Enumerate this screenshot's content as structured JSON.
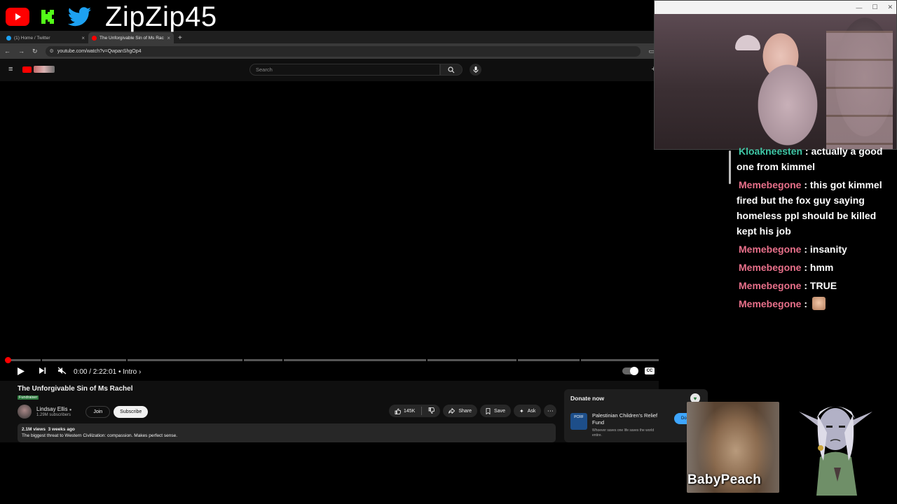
{
  "overlay": {
    "handle": "ZipZip45",
    "icons": [
      "youtube-icon",
      "kick-icon",
      "twitter-icon"
    ]
  },
  "browser": {
    "tabs": [
      {
        "label": "(1) Home / Twitter",
        "active": false
      },
      {
        "label": "The Unforgivable Sin of Ms Rac",
        "active": true
      }
    ],
    "url": "youtube.com/watch?v=QwpanShgOp4"
  },
  "youtube": {
    "search_placeholder": "Search",
    "player": {
      "timecode": "0:00 / 2:22:01",
      "chapter": "Intro",
      "progress": 0
    },
    "video": {
      "title": "The Unforgivable Sin of Ms Rachel",
      "badge": "Fundraiser",
      "channel": "Lindsay Ellis",
      "subscribers": "1.29M subscribers",
      "join_label": "Join",
      "subscribe_label": "Subscribe",
      "likes": "145K",
      "share_label": "Share",
      "save_label": "Save",
      "ask_label": "Ask",
      "views": "2.1M views",
      "age": "3 weeks ago",
      "description": "The biggest threat to Western Civilization: compassion. Makes perfect sense."
    },
    "donate": {
      "title": "Donate now",
      "logo_text": "PCRF",
      "org": "Palestinian Children's Relief Fund",
      "tagline": "Whoever saves one life saves the world entire.",
      "button": "Do"
    }
  },
  "chat": {
    "messages": [
      {
        "user": "Kloakneesten",
        "text": "actually a good one from kimmel",
        "color": "#3fc7a6"
      },
      {
        "user": "Memebegone",
        "text": "this got kimmel fired but the fox guy saying homeless ppl should be killed kept his job",
        "color": "#e8708a"
      },
      {
        "user": "Memebegone",
        "text": "insanity",
        "color": "#e8708a"
      },
      {
        "user": "Memebegone",
        "text": "hmm",
        "color": "#e8708a"
      },
      {
        "user": "Memebegone",
        "text": "TRUE",
        "color": "#e8708a"
      },
      {
        "user": "Memebegone",
        "text": "",
        "color": "#e8708a",
        "emote": true
      }
    ]
  },
  "overlay_bottom": {
    "name_label": "BabyPeach"
  }
}
